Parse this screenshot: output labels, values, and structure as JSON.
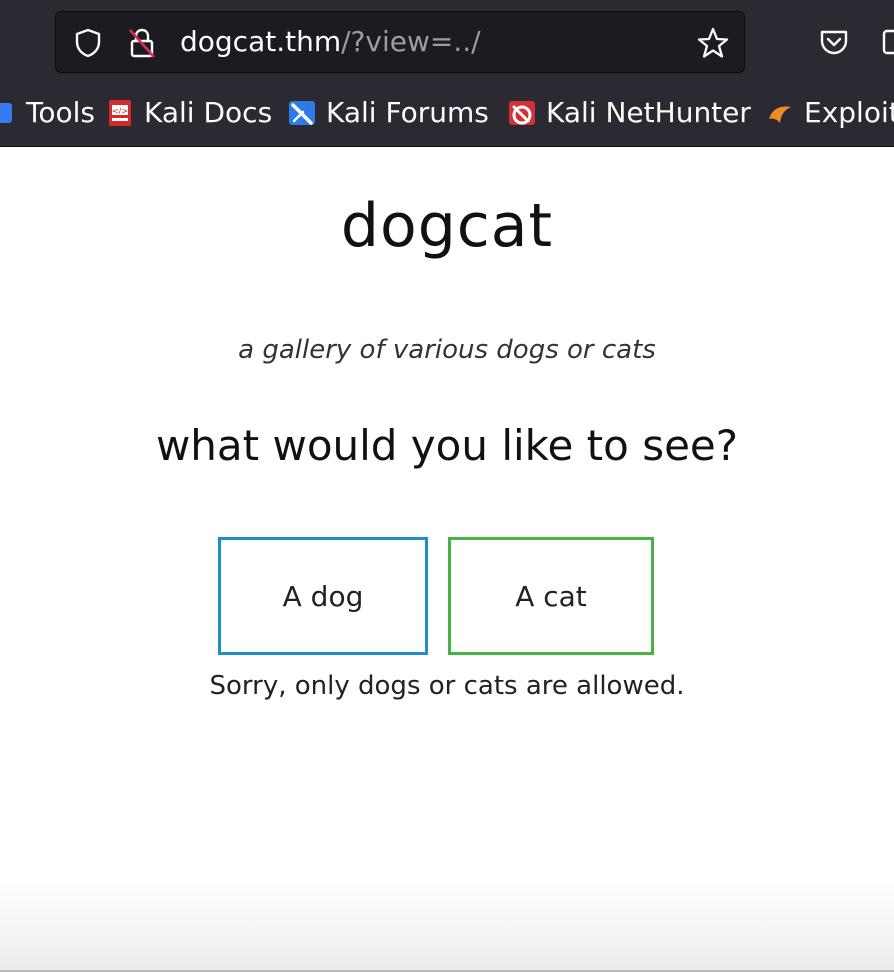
{
  "browser": {
    "url_host": "dogcat.thm",
    "url_path": "/?view=../",
    "bookmarks": [
      {
        "label": "Tools",
        "icon": "kali-tools-icon"
      },
      {
        "label": "Kali Docs",
        "icon": "kali-docs-icon"
      },
      {
        "label": "Kali Forums",
        "icon": "kali-forums-icon"
      },
      {
        "label": "Kali NetHunter",
        "icon": "kali-nethunter-icon"
      },
      {
        "label": "Exploit",
        "icon": "exploit-db-icon"
      }
    ]
  },
  "page": {
    "title": "dogcat",
    "tagline": "a gallery of various dogs or cats",
    "question": "what would you like to see?",
    "buttons": {
      "dog": "A dog",
      "cat": "A cat"
    },
    "notice": "Sorry, only dogs or cats are allowed."
  },
  "colors": {
    "dog_border": "#1d8fc4",
    "cat_border": "#47b347",
    "chrome_bg": "#2b2a33"
  }
}
